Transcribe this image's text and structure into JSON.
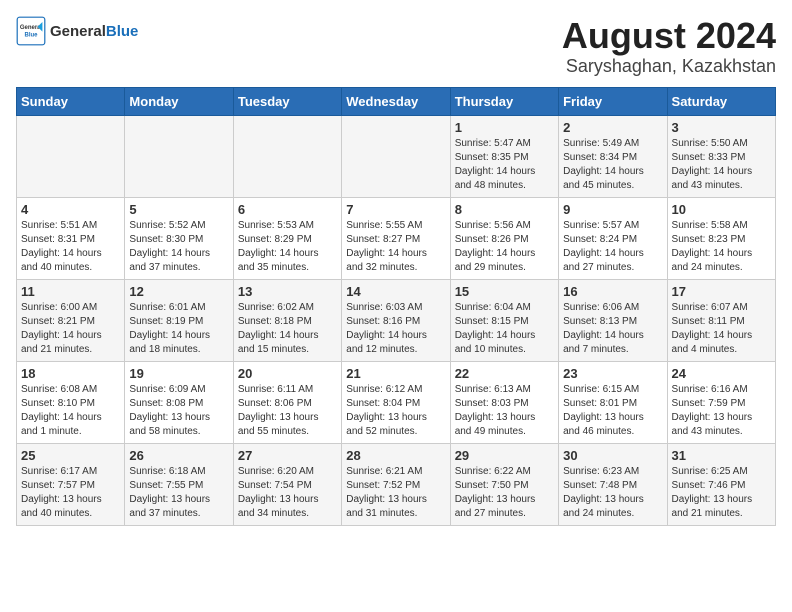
{
  "header": {
    "logo_line1": "General",
    "logo_line2": "Blue",
    "main_title": "August 2024",
    "subtitle": "Saryshaghan, Kazakhstan"
  },
  "calendar": {
    "days_of_week": [
      "Sunday",
      "Monday",
      "Tuesday",
      "Wednesday",
      "Thursday",
      "Friday",
      "Saturday"
    ],
    "weeks": [
      [
        {
          "day": "",
          "info": ""
        },
        {
          "day": "",
          "info": ""
        },
        {
          "day": "",
          "info": ""
        },
        {
          "day": "",
          "info": ""
        },
        {
          "day": "1",
          "info": "Sunrise: 5:47 AM\nSunset: 8:35 PM\nDaylight: 14 hours\nand 48 minutes."
        },
        {
          "day": "2",
          "info": "Sunrise: 5:49 AM\nSunset: 8:34 PM\nDaylight: 14 hours\nand 45 minutes."
        },
        {
          "day": "3",
          "info": "Sunrise: 5:50 AM\nSunset: 8:33 PM\nDaylight: 14 hours\nand 43 minutes."
        }
      ],
      [
        {
          "day": "4",
          "info": "Sunrise: 5:51 AM\nSunset: 8:31 PM\nDaylight: 14 hours\nand 40 minutes."
        },
        {
          "day": "5",
          "info": "Sunrise: 5:52 AM\nSunset: 8:30 PM\nDaylight: 14 hours\nand 37 minutes."
        },
        {
          "day": "6",
          "info": "Sunrise: 5:53 AM\nSunset: 8:29 PM\nDaylight: 14 hours\nand 35 minutes."
        },
        {
          "day": "7",
          "info": "Sunrise: 5:55 AM\nSunset: 8:27 PM\nDaylight: 14 hours\nand 32 minutes."
        },
        {
          "day": "8",
          "info": "Sunrise: 5:56 AM\nSunset: 8:26 PM\nDaylight: 14 hours\nand 29 minutes."
        },
        {
          "day": "9",
          "info": "Sunrise: 5:57 AM\nSunset: 8:24 PM\nDaylight: 14 hours\nand 27 minutes."
        },
        {
          "day": "10",
          "info": "Sunrise: 5:58 AM\nSunset: 8:23 PM\nDaylight: 14 hours\nand 24 minutes."
        }
      ],
      [
        {
          "day": "11",
          "info": "Sunrise: 6:00 AM\nSunset: 8:21 PM\nDaylight: 14 hours\nand 21 minutes."
        },
        {
          "day": "12",
          "info": "Sunrise: 6:01 AM\nSunset: 8:19 PM\nDaylight: 14 hours\nand 18 minutes."
        },
        {
          "day": "13",
          "info": "Sunrise: 6:02 AM\nSunset: 8:18 PM\nDaylight: 14 hours\nand 15 minutes."
        },
        {
          "day": "14",
          "info": "Sunrise: 6:03 AM\nSunset: 8:16 PM\nDaylight: 14 hours\nand 12 minutes."
        },
        {
          "day": "15",
          "info": "Sunrise: 6:04 AM\nSunset: 8:15 PM\nDaylight: 14 hours\nand 10 minutes."
        },
        {
          "day": "16",
          "info": "Sunrise: 6:06 AM\nSunset: 8:13 PM\nDaylight: 14 hours\nand 7 minutes."
        },
        {
          "day": "17",
          "info": "Sunrise: 6:07 AM\nSunset: 8:11 PM\nDaylight: 14 hours\nand 4 minutes."
        }
      ],
      [
        {
          "day": "18",
          "info": "Sunrise: 6:08 AM\nSunset: 8:10 PM\nDaylight: 14 hours\nand 1 minute."
        },
        {
          "day": "19",
          "info": "Sunrise: 6:09 AM\nSunset: 8:08 PM\nDaylight: 13 hours\nand 58 minutes."
        },
        {
          "day": "20",
          "info": "Sunrise: 6:11 AM\nSunset: 8:06 PM\nDaylight: 13 hours\nand 55 minutes."
        },
        {
          "day": "21",
          "info": "Sunrise: 6:12 AM\nSunset: 8:04 PM\nDaylight: 13 hours\nand 52 minutes."
        },
        {
          "day": "22",
          "info": "Sunrise: 6:13 AM\nSunset: 8:03 PM\nDaylight: 13 hours\nand 49 minutes."
        },
        {
          "day": "23",
          "info": "Sunrise: 6:15 AM\nSunset: 8:01 PM\nDaylight: 13 hours\nand 46 minutes."
        },
        {
          "day": "24",
          "info": "Sunrise: 6:16 AM\nSunset: 7:59 PM\nDaylight: 13 hours\nand 43 minutes."
        }
      ],
      [
        {
          "day": "25",
          "info": "Sunrise: 6:17 AM\nSunset: 7:57 PM\nDaylight: 13 hours\nand 40 minutes."
        },
        {
          "day": "26",
          "info": "Sunrise: 6:18 AM\nSunset: 7:55 PM\nDaylight: 13 hours\nand 37 minutes."
        },
        {
          "day": "27",
          "info": "Sunrise: 6:20 AM\nSunset: 7:54 PM\nDaylight: 13 hours\nand 34 minutes."
        },
        {
          "day": "28",
          "info": "Sunrise: 6:21 AM\nSunset: 7:52 PM\nDaylight: 13 hours\nand 31 minutes."
        },
        {
          "day": "29",
          "info": "Sunrise: 6:22 AM\nSunset: 7:50 PM\nDaylight: 13 hours\nand 27 minutes."
        },
        {
          "day": "30",
          "info": "Sunrise: 6:23 AM\nSunset: 7:48 PM\nDaylight: 13 hours\nand 24 minutes."
        },
        {
          "day": "31",
          "info": "Sunrise: 6:25 AM\nSunset: 7:46 PM\nDaylight: 13 hours\nand 21 minutes."
        }
      ]
    ]
  }
}
